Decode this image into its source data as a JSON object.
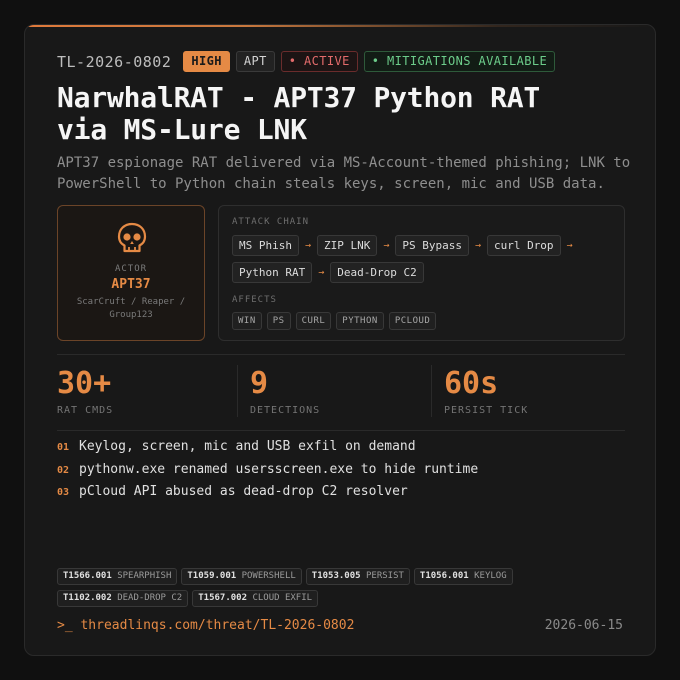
{
  "header": {
    "threat_id": "TL-2026-0802",
    "badges": {
      "severity": "HIGH",
      "type": "APT",
      "status": "• ACTIVE",
      "mitigations": "• MITIGATIONS AVAILABLE"
    }
  },
  "title_line1": "NarwhalRAT - APT37 Python RAT",
  "title_line2": "via MS-Lure LNK",
  "subtitle_line1": "APT37 espionage RAT delivered via MS-Account-themed phishing; LNK to",
  "subtitle_line2": "PowerShell to Python chain steals keys, screen, mic and USB data.",
  "actor": {
    "icon": "skull-icon",
    "label": "ACTOR",
    "name": "APT37",
    "alias_line1": "ScarCruft / Reaper /",
    "alias_line2": "Group123"
  },
  "attack_chain": {
    "label": "ATTACK CHAIN",
    "steps": [
      "MS Phish",
      "ZIP LNK",
      "PS Bypass",
      "curl Drop",
      "Python RAT",
      "Dead-Drop C2"
    ],
    "arrow": "→"
  },
  "affects": {
    "label": "AFFECTS",
    "tags": [
      "WIN",
      "PS",
      "CURL",
      "PYTHON",
      "PCLOUD"
    ]
  },
  "stats": [
    {
      "value": "30+",
      "label": "RAT CMDS"
    },
    {
      "value": "9",
      "label": "DETECTIONS"
    },
    {
      "value": "60s",
      "label": "PERSIST TICK"
    }
  ],
  "findings": [
    {
      "num": "01",
      "text": "Keylog, screen, mic and USB exfil on demand"
    },
    {
      "num": "02",
      "text": "pythonw.exe renamed usersscreen.exe to hide runtime"
    },
    {
      "num": "03",
      "text": "pCloud API abused as dead-drop C2 resolver"
    }
  ],
  "techniques": [
    {
      "id": "T1566.001",
      "name": "SPEARPHISH"
    },
    {
      "id": "T1059.001",
      "name": "POWERSHELL"
    },
    {
      "id": "T1053.005",
      "name": "PERSIST"
    },
    {
      "id": "T1056.001",
      "name": "KEYLOG"
    },
    {
      "id": "T1102.002",
      "name": "DEAD-DROP C2"
    },
    {
      "id": "T1567.002",
      "name": "CLOUD EXFIL"
    }
  ],
  "footer": {
    "link": ">_ threadlinqs.com/threat/TL-2026-0802",
    "date": "2026-06-15"
  },
  "colors": {
    "accent": "#e58a45",
    "active": "#e36b6b",
    "mitigation": "#6ccc8a",
    "background": "#181818"
  }
}
